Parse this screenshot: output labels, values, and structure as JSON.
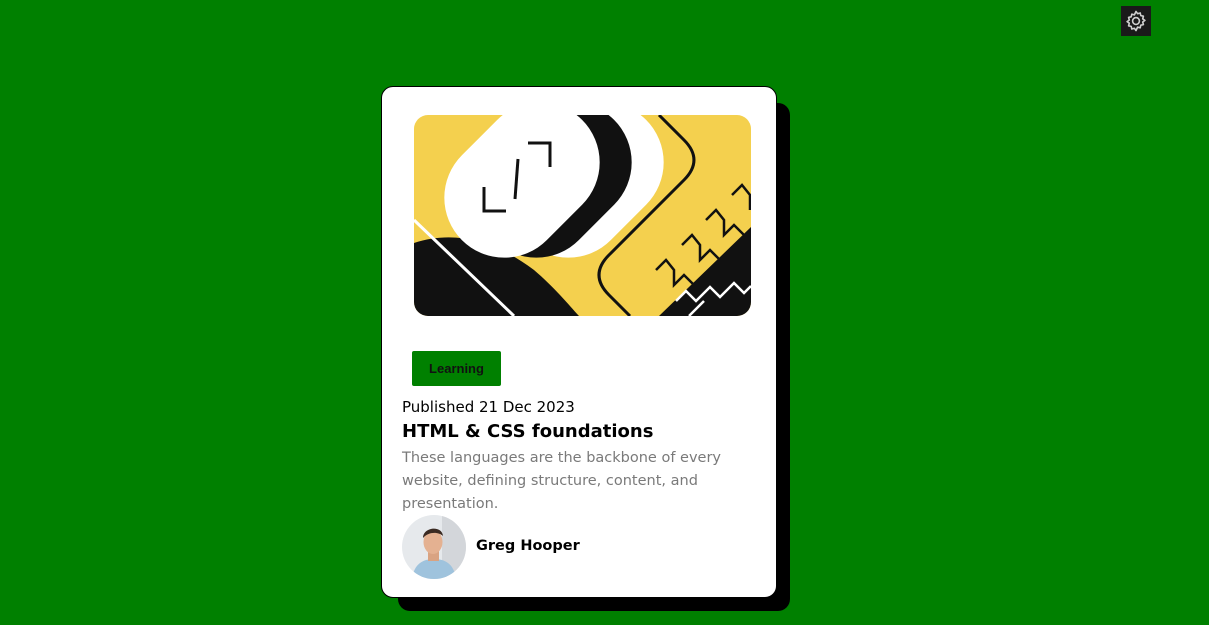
{
  "settings": {
    "icon": "gear-icon"
  },
  "card": {
    "hero_icon": "code-illustration",
    "tag": "Learning",
    "published": "Published 21 Dec 2023",
    "title": "HTML & CSS foundations",
    "description": "These languages are the backbone of every website, defining structure, content, and presentation.",
    "author": {
      "name": "Greg Hooper",
      "avatar": "avatar-photo"
    }
  },
  "colors": {
    "background": "#008000",
    "tag_bg": "#008000",
    "card_bg": "#ffffff",
    "illustration_yellow": "#f4d04e"
  }
}
